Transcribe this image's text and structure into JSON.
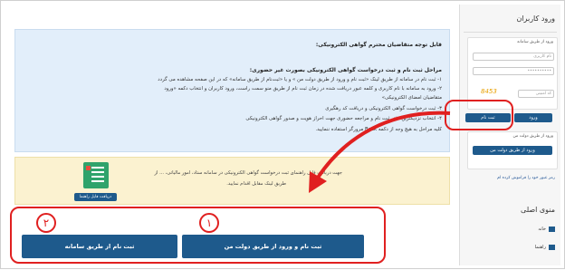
{
  "sidebar": {
    "title": "ورود کاربران",
    "login_group_title": "ورود از طریق سامانه",
    "username_placeholder": "نام کاربری",
    "password_value": "••••••••••",
    "captcha_placeholder": "کد امنیتی",
    "captcha_text": "8453",
    "login_button": "ورود",
    "register_button": "ثبت نام",
    "dolat_group_title": "ورود از طریق دولت من",
    "dolat_button": "ورود از طریق دولت من",
    "forgot_link": "رمز عبور خود را فراموش کرده ام",
    "menu_title": "منوی اصلی",
    "menu_items": [
      "خانه",
      "راهنما"
    ]
  },
  "notice": {
    "heading": "قابل توجه متقاضیان محترم گواهی الکترونیکی:",
    "subheading": "مراحل ثبت نام و ثبت درخواست گواهی الکترونیکی بصورت غیر حضوری:",
    "lines": [
      "۱- ثبت نام در سامانه از طریق لینک «ثبت نام و ورود از طریق دولت من » و یا «ثبت‌نام از طریق سامانه» که در این صفحه مشاهده می گردد",
      "۲- ورود به سامانه با نام کاربری و کلمه عبور دریافت شده در زمان ثبت نام از طریق منو سمت راست، ورود کاربران و انتخاب دکمه «ورود",
      "متقاضیان امضای الکترونیکی»",
      "۳- ثبت درخواست گواهی الکترونیکی و دریافت کد رهگیری",
      "۴- انتخاب نزدیکترین دفتر ثبت نام و مراجعه حضوری جهت احراز هویت و صدور گواهی الکترونیکی",
      "کلیه مراحل به هیچ وجه از دکمه Back مرورگر استفاده ننمایید."
    ]
  },
  "guide": {
    "line1": "جهت دریافت فایل راهنمای ثبت درخواست گواهی الکترونیکی در سامانه ستاد، امور مالیاتی، ... از",
    "line2": "طریق لینک مقابل اقدام نمایید.",
    "download_button": "دریافت فایل راهنما"
  },
  "actions": {
    "dolat_register": "ثبت نام و ورود از طریق دولت من",
    "system_register": "ثبت نام از طریق سامانه"
  },
  "annotations": {
    "label_1": "۱",
    "label_2": "۲",
    "color": "#e02020"
  }
}
